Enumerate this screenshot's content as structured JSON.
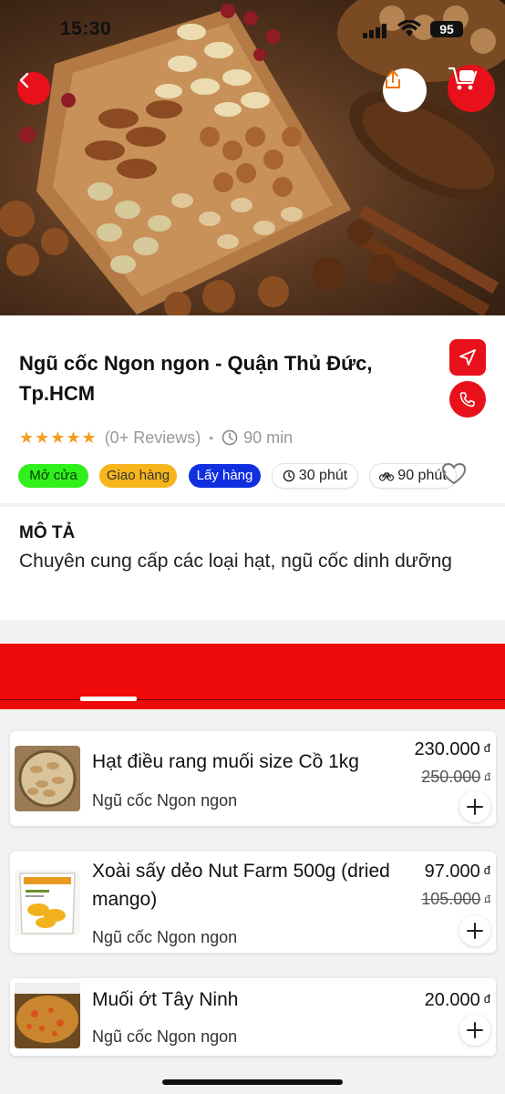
{
  "status_bar": {
    "time": "15:30",
    "battery": "95"
  },
  "header": {
    "cart_count": "0"
  },
  "shop": {
    "title": "Ngũ cốc Ngon ngon - Quận Thủ Đức, Tp.HCM",
    "stars": "★★★★★",
    "reviews": "(0+ Reviews)",
    "separator": "•",
    "duration": "90 min",
    "tags": {
      "open": "Mở cửa",
      "delivery": "Giao hàng",
      "pickup": "Lấy hàng",
      "prep_time": "30 phút",
      "ship_time": "90 phút"
    },
    "tag_colors": {
      "open": "#2ff01a",
      "delivery": "#f7b41b",
      "pickup": "#1030e0"
    }
  },
  "description": {
    "title": "MÔ TẢ",
    "text": "Chuyên cung cấp các loại hạt, ngũ cốc dinh dưỡng"
  },
  "accent_color": "#e8101a",
  "products": [
    {
      "name": "Hạt điều rang muối size Cồ 1kg",
      "shop": "Ngũ cốc Ngon ngon",
      "price": "230.000",
      "old_price": "250.000",
      "currency": "đ",
      "thumb_icon": "cashew-jar-image"
    },
    {
      "name": "Xoài sấy dẻo Nut Farm 500g (dried mango)",
      "shop": "Ngũ cốc Ngon ngon",
      "price": "97.000",
      "old_price": "105.000",
      "currency": "đ",
      "thumb_icon": "dried-mango-bag-image"
    },
    {
      "name": "Muối ớt Tây Ninh",
      "shop": "Ngũ cốc Ngon ngon",
      "price": "20.000",
      "currency": "đ",
      "thumb_icon": "chili-salt-image"
    }
  ]
}
